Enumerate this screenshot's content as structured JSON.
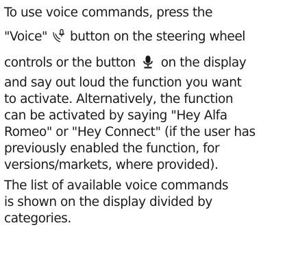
{
  "document": {
    "paragraph1": {
      "line1": "To use voice commands, press the",
      "line2_before": "\"Voice\"",
      "line2_after": "button on the steering wheel",
      "line3_before": "controls or the button",
      "line3_after": "on the display",
      "line4": "and say out loud the function you want",
      "line5": "to activate. Alternatively, the function",
      "line6": "can be activated by saying \"Hey Alfa",
      "line7": "Romeo\" or \"Hey Connect\" (if the user has",
      "line8": "previously enabled the function, for",
      "line9": "versions/markets, where provided)."
    },
    "paragraph2": {
      "line1": "The list of available voice commands",
      "line2": "is shown on the display divided by",
      "line3": "categories."
    },
    "icons": {
      "steering_wheel_voice": "voice-command-hand-icon",
      "display_voice": "microphone-icon"
    }
  }
}
